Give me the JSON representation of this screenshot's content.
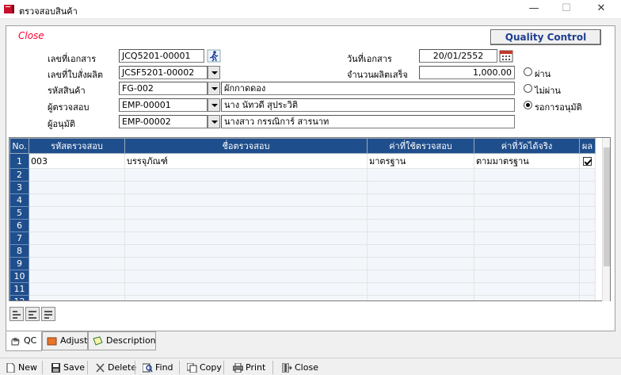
{
  "window": {
    "title": "ตรวจสอบสินค้า",
    "minimize": "—",
    "maximize": "☐",
    "close": "✕"
  },
  "form": {
    "close_label": "Close",
    "qc_label": "Quality Control",
    "doc_no_label": "เลขที่เอกสาร",
    "doc_no": "JCQ5201-00001",
    "prod_order_label": "เลขที่ใบสั่งผลิต",
    "prod_order": "JCSF5201-00002",
    "product_code_label": "รหัสสินค้า",
    "product_code": "FG-002",
    "product_name": "ผักกาดดอง",
    "inspector_label": "ผู้ตรวจสอบ",
    "inspector_code": "EMP-00001",
    "inspector_name": "นาง นัทวดี สุประวิติ",
    "approver_label": "ผู้อนุมัติ",
    "approver_code": "EMP-00002",
    "approver_name": "นางสาว กรรณิการ์ สารนาท",
    "doc_date_label": "วันที่เอกสาร",
    "doc_date": "20/01/2552",
    "qty_label": "จำนวนผลิตเสร็จ",
    "qty": "1,000.00",
    "status_options": [
      {
        "label": "ผ่าน",
        "selected": false
      },
      {
        "label": "ไม่ผ่าน",
        "selected": false
      },
      {
        "label": "รอการอนุมัติ",
        "selected": true
      }
    ]
  },
  "grid": {
    "columns": [
      "No.",
      "รหัสตรวจสอบ",
      "ชื่อตรวจสอบ",
      "ค่าที่ใช้ตรวจสอบ",
      "ค่าที่วัดได้จริง",
      "ผล"
    ],
    "rows": [
      {
        "no": "1",
        "code": "003",
        "name": "บรรจุภัณฑ์",
        "standard": "มาตรฐาน",
        "actual": "ตามมาตรฐาน",
        "result": true
      },
      {
        "no": "2",
        "code": "",
        "name": "",
        "standard": "",
        "actual": "",
        "result": null
      },
      {
        "no": "3",
        "code": "",
        "name": "",
        "standard": "",
        "actual": "",
        "result": null
      },
      {
        "no": "4",
        "code": "",
        "name": "",
        "standard": "",
        "actual": "",
        "result": null
      },
      {
        "no": "5",
        "code": "",
        "name": "",
        "standard": "",
        "actual": "",
        "result": null
      },
      {
        "no": "6",
        "code": "",
        "name": "",
        "standard": "",
        "actual": "",
        "result": null
      },
      {
        "no": "7",
        "code": "",
        "name": "",
        "standard": "",
        "actual": "",
        "result": null
      },
      {
        "no": "8",
        "code": "",
        "name": "",
        "standard": "",
        "actual": "",
        "result": null
      },
      {
        "no": "9",
        "code": "",
        "name": "",
        "standard": "",
        "actual": "",
        "result": null
      },
      {
        "no": "10",
        "code": "",
        "name": "",
        "standard": "",
        "actual": "",
        "result": null
      },
      {
        "no": "11",
        "code": "",
        "name": "",
        "standard": "",
        "actual": "",
        "result": null
      },
      {
        "no": "12",
        "code": "",
        "name": "",
        "standard": "",
        "actual": "",
        "result": null
      }
    ]
  },
  "tabs": [
    {
      "label": "QC",
      "icon": "hands-icon",
      "active": true
    },
    {
      "label": "Adjust",
      "icon": "adjust-icon",
      "active": false
    },
    {
      "label": "Description",
      "icon": "description-icon",
      "active": false
    }
  ],
  "toolbar": {
    "new": "New",
    "save": "Save",
    "delete": "Delete",
    "find": "Find",
    "copy": "Copy",
    "print": "Print",
    "close": "Close"
  },
  "colors": {
    "header_blue": "#1f4e8c",
    "close_red": "#ff0033",
    "qc_text": "#1f3f8f"
  }
}
